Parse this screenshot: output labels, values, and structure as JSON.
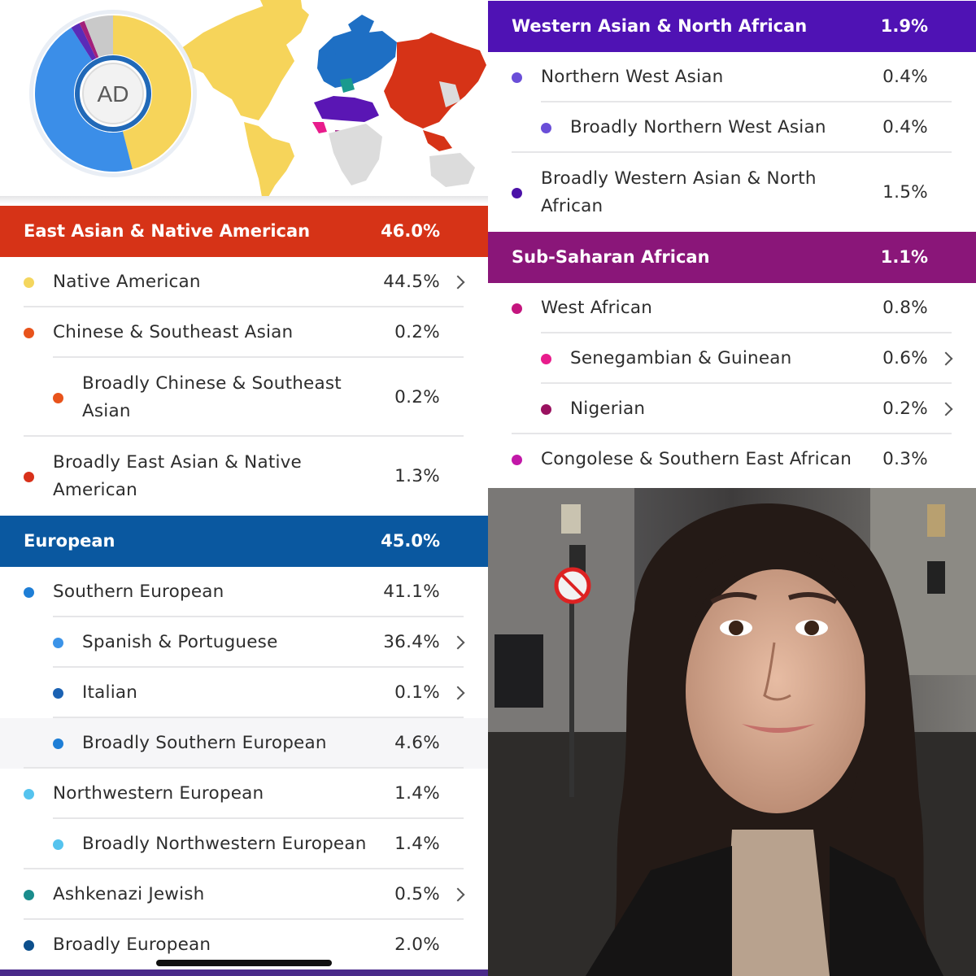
{
  "donut": {
    "initials": "AD",
    "segments": [
      {
        "value": 46.0,
        "color": "#f6d45a"
      },
      {
        "value": 45.0,
        "color": "#3b8ee8"
      },
      {
        "value": 1.9,
        "color": "#5a2bb8"
      },
      {
        "value": 1.1,
        "color": "#a3207a"
      },
      {
        "value": 6.0,
        "color": "#c9c9c9"
      }
    ]
  },
  "left": {
    "east_asian": {
      "name": "East Asian & Native American",
      "percent": "46.0%",
      "color": "#d63317",
      "rows": [
        {
          "label": "Native American",
          "percent": "44.5%",
          "dot": "#f4d65e",
          "indent": false,
          "chevron": true
        },
        {
          "label": "Chinese & Southeast Asian",
          "percent": "0.2%",
          "dot": "#e8531b",
          "indent": false,
          "chevron": false
        },
        {
          "label": "Broadly Chinese & Southeast",
          "label2": "Asian",
          "percent": "0.2%",
          "dot": "#e8531b",
          "indent": true,
          "chevron": false
        },
        {
          "label": "Broadly East Asian & Native",
          "label2": "American",
          "percent": "1.3%",
          "dot": "#d8311a",
          "indent": false,
          "chevron": false
        }
      ]
    },
    "european": {
      "name": "European",
      "percent": "45.0%",
      "color": "#0a58a0",
      "rows": [
        {
          "label": "Southern European",
          "percent": "41.1%",
          "dot": "#1e7ed6",
          "indent": false,
          "chevron": false
        },
        {
          "label": "Spanish & Portuguese",
          "percent": "36.4%",
          "dot": "#3b93e8",
          "indent": true,
          "chevron": true
        },
        {
          "label": "Italian",
          "percent": "0.1%",
          "dot": "#1b62b3",
          "indent": true,
          "chevron": true
        },
        {
          "label": "Broadly Southern European",
          "percent": "4.6%",
          "dot": "#1e7ed6",
          "indent": true,
          "chevron": false,
          "highlight": true
        },
        {
          "label": "Northwestern European",
          "percent": "1.4%",
          "dot": "#55c3ee",
          "indent": false,
          "chevron": false
        },
        {
          "label": "Broadly Northwestern European",
          "percent": "1.4%",
          "dot": "#55c3ee",
          "indent": true,
          "chevron": false
        },
        {
          "label": "Ashkenazi Jewish",
          "percent": "0.5%",
          "dot": "#1a8c8c",
          "indent": false,
          "chevron": true
        },
        {
          "label": "Broadly European",
          "percent": "2.0%",
          "dot": "#0c4f8c",
          "indent": false,
          "chevron": false
        }
      ]
    }
  },
  "right": {
    "western_asian": {
      "name": "Western Asian & North African",
      "percent": "1.9%",
      "color": "#4f12b4",
      "rows": [
        {
          "label": "Northern West Asian",
          "percent": "0.4%",
          "dot": "#6a4ed8",
          "indent": false,
          "chevron": false
        },
        {
          "label": "Broadly Northern West Asian",
          "percent": "0.4%",
          "dot": "#6a4ed8",
          "indent": true,
          "chevron": false
        },
        {
          "label": "Broadly Western Asian & North",
          "label2": "African",
          "percent": "1.5%",
          "dot": "#4b11a8",
          "indent": false,
          "chevron": false
        }
      ]
    },
    "sub_saharan": {
      "name": "Sub-Saharan African",
      "percent": "1.1%",
      "color": "#8a1679",
      "rows": [
        {
          "label": "West African",
          "percent": "0.8%",
          "dot": "#c4157e",
          "indent": false,
          "chevron": false
        },
        {
          "label": "Senegambian & Guinean",
          "percent": "0.6%",
          "dot": "#e81c8c",
          "indent": true,
          "chevron": true
        },
        {
          "label": "Nigerian",
          "percent": "0.2%",
          "dot": "#9a1260",
          "indent": true,
          "chevron": true
        },
        {
          "label": "Congolese & Southern East African",
          "percent": "0.3%",
          "dot": "#c218a8",
          "indent": false,
          "chevron": false
        }
      ]
    }
  },
  "colors": {
    "map_americas": "#f6d45a",
    "map_europe": "#1e6fc4",
    "map_asia": "#d63317",
    "map_africa_north": "#5a16b4",
    "map_africa_west": "#a31e86",
    "map_gray": "#dcdcdc"
  }
}
